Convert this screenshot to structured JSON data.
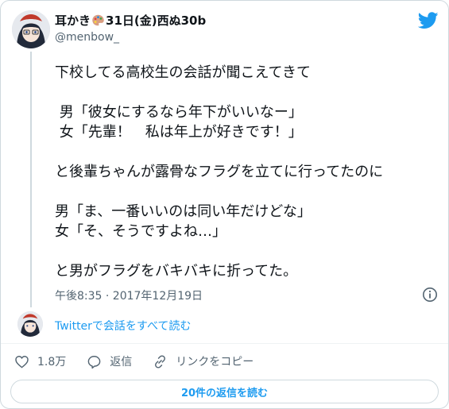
{
  "author": {
    "name_prefix": "耳かき",
    "name_suffix": "31日(金)西ぬ30b",
    "handle": "@menbow_"
  },
  "tweet": {
    "lines": [
      "下校してる高校生の会話が聞こえてきて",
      "",
      " 男「彼女にするなら年下がいいなー」",
      " 女「先輩！　私は年上が好きです！」",
      "",
      "と後輩ちゃんが露骨なフラグを立てに行ってたのに",
      "",
      "男「ま、一番いいのは同い年だけどな」",
      "女「そ、そうですよね…」",
      "",
      "と男がフラグをバキバキに折ってた。"
    ],
    "timestamp": "午後8:35 · 2017年12月19日"
  },
  "conversation_link": "Twitterで会話をすべて読む",
  "actions": {
    "like_count": "1.8万",
    "reply_label": "返信",
    "copy_link_label": "リンクをコピー"
  },
  "replies_button": "20件の返信を読む",
  "icons": [
    "twitter-bird-icon",
    "palette-emoji-icon",
    "info-icon",
    "heart-icon",
    "reply-icon",
    "link-icon"
  ],
  "colors": {
    "accent": "#1d9bf0",
    "secondary_text": "#536471",
    "border": "#cfd9de"
  }
}
